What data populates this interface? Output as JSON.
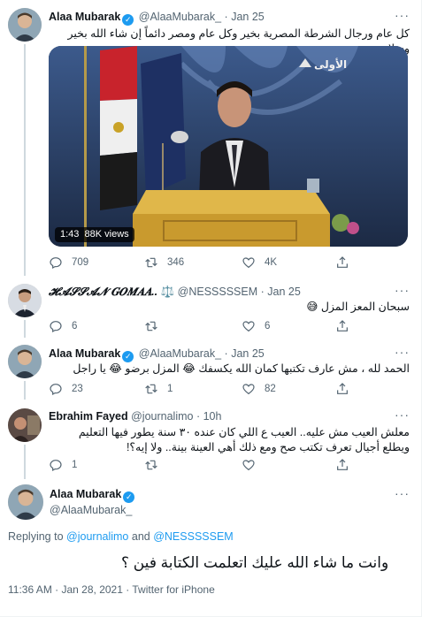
{
  "tweet1": {
    "name": "Alaa Mubarak",
    "handle": "@AlaaMubarak_",
    "dot": "·",
    "date": "Jan 25",
    "text": "كل عام ورجال الشرطة المصرية بخير وكل عام ومصر دائماً إن شاء الله بخير وسلام .",
    "video": {
      "time": "1:43",
      "views": "88K views",
      "channel_logo": "الأولى"
    },
    "replies": "709",
    "retweets": "346",
    "likes": "4K"
  },
  "tweet2": {
    "name": "𝓗𝓐𝓢𝓢𝓐𝓝 𝑮𝑶𝑴𝑨𝑨..",
    "emoji": "⚖️",
    "handle": "@NESSSSSEM",
    "dot": "·",
    "date": "Jan 25",
    "text": "سبحان المعز المزل 😅",
    "replies": "6",
    "retweets": "",
    "likes": "6"
  },
  "tweet3": {
    "name": "Alaa Mubarak",
    "handle": "@AlaaMubarak_",
    "dot": "·",
    "date": "Jan 25",
    "text": "الحمد لله ، مش عارف تكتبها كمان الله يكسفك 😂 المزل برضو 😂 يا راجل",
    "replies": "23",
    "retweets": "1",
    "likes": "82"
  },
  "tweet4": {
    "name": "Ebrahim Fayed",
    "handle": "@journalimo",
    "dot": "·",
    "date": "10h",
    "text": "معلش العيب مش عليه.. العيب ع اللي كان عنده ٣٠ سنة يطور فيها التعليم ويطلع أجيال تعرف تكتب صح ومع ذلك أهي العينة بينة.. ولا إيه؟!",
    "replies": "1",
    "retweets": "",
    "likes": ""
  },
  "main": {
    "name": "Alaa Mubarak",
    "handle": "@AlaaMubarak_",
    "replying_prefix": "Replying to",
    "replying_to_1": "@journalimo",
    "replying_and": "and",
    "replying_to_2": "@NESSSSSEM",
    "text": "وانت ما شاء الله عليك اتعلمت الكتابة فين ؟",
    "time": "11:36 AM",
    "dot": "·",
    "date": "Jan 28, 2021",
    "source": "Twitter for iPhone"
  },
  "more_icon": "···",
  "colors": {
    "accent": "#1d9bf0",
    "muted": "#536471",
    "text": "#0f1419",
    "border": "#eff3f4"
  }
}
